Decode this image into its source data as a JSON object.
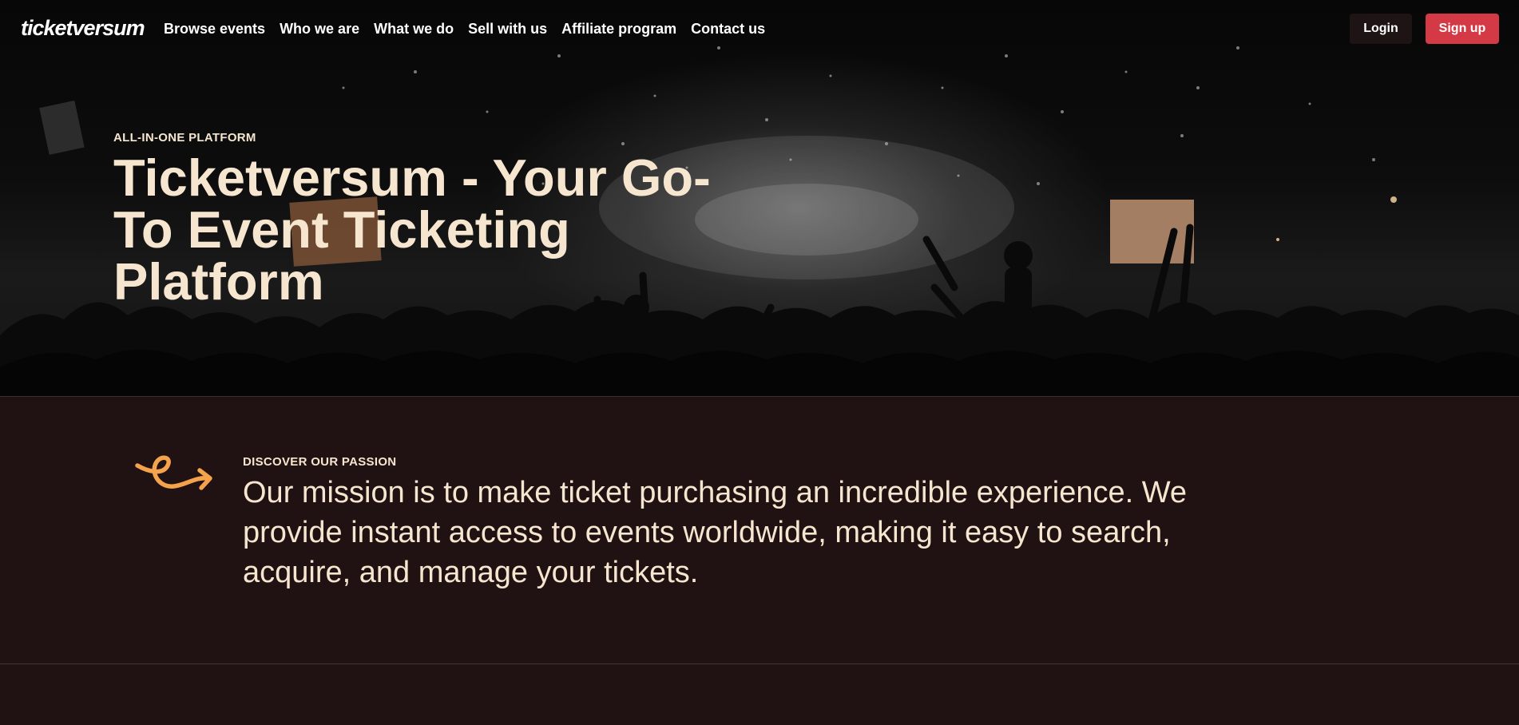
{
  "brand": {
    "logo": "ticketversum"
  },
  "nav": {
    "links": [
      "Browse events",
      "Who we are",
      "What we do",
      "Sell with us",
      "Affiliate program",
      "Contact us"
    ],
    "login_label": "Login",
    "signup_label": "Sign up"
  },
  "hero": {
    "eyebrow": "ALL-IN-ONE PLATFORM",
    "title": "Ticketversum - Your Go-To Event Ticketing Platform"
  },
  "mission": {
    "eyebrow": "DISCOVER OUR PASSION",
    "text": "Our mission is to make ticket purchasing an incredible experience. We provide instant access to events worldwide, making it easy to search, acquire, and manage your tickets."
  },
  "colors": {
    "accent_red": "#d33a45",
    "cream_text": "#f6e6cf",
    "dark_brown_bg": "#201212",
    "icon_orange": "#f4a24c"
  },
  "icons": {
    "mission_icon": "curly-arrow-icon"
  }
}
